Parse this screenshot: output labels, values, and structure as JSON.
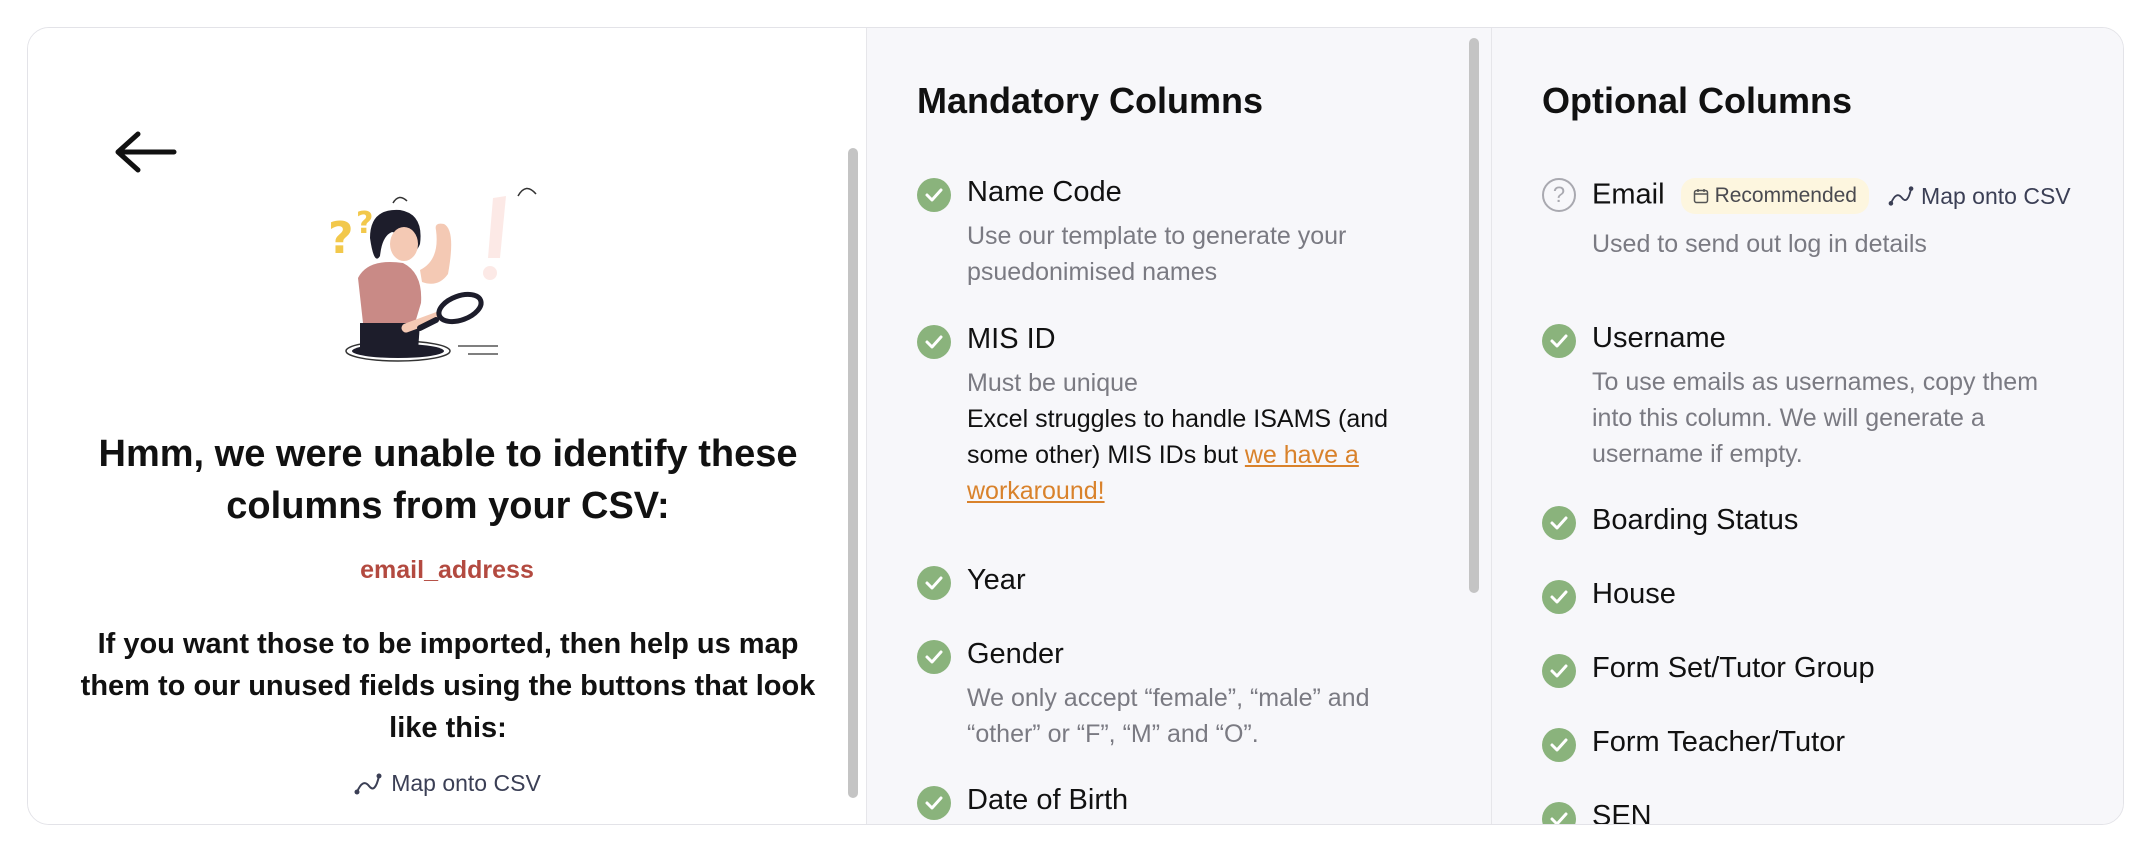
{
  "left": {
    "headline": "Hmm, we were unable to identify these columns from your CSV:",
    "unmatched_columns": [
      "email_address"
    ],
    "instructions": "If you want those to be imported, then help us map them to our unused fields using the buttons that look like this:",
    "map_hint_label": "Map onto CSV"
  },
  "mandatory": {
    "title": "Mandatory Columns",
    "items": [
      {
        "label": "Name Code",
        "description": "Use our template to generate your psuedonimised names"
      },
      {
        "label": "MIS ID",
        "description": "Must be unique",
        "note": "Excel struggles to handle ISAMS (and some other) MIS IDs but ",
        "note_link": "we have a workaround!"
      },
      {
        "label": "Year"
      },
      {
        "label": "Gender",
        "description": "We only accept “female”, “male” and “other” or “F”, “M” and “O”."
      },
      {
        "label": "Date of Birth"
      }
    ]
  },
  "optional": {
    "title": "Optional Columns",
    "items": [
      {
        "label": "Email",
        "badge": "Recommended",
        "map_label": "Map onto CSV",
        "description": "Used to send out log in details",
        "status": "unmapped"
      },
      {
        "label": "Username",
        "description": "To use emails as usernames, copy them into this column. We will generate a username if empty.",
        "status": "ok"
      },
      {
        "label": "Boarding Status",
        "status": "ok"
      },
      {
        "label": "House",
        "status": "ok"
      },
      {
        "label": "Form Set/Tutor Group",
        "status": "ok"
      },
      {
        "label": "Form Teacher/Tutor",
        "status": "ok"
      },
      {
        "label": "SEN",
        "status": "ok"
      }
    ]
  },
  "colors": {
    "check_green": "#8ab37c",
    "unmatched_red": "#b34a40",
    "link_orange": "#d9822b",
    "badge_bg": "#fdf6df"
  }
}
